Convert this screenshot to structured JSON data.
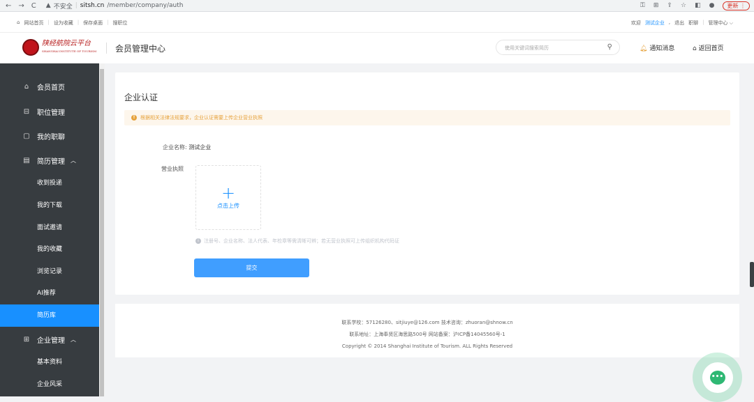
{
  "browser": {
    "back": "←",
    "forward": "→",
    "reload": "C",
    "insecure": "不安全",
    "host": "sitsh.cn",
    "path": "/member/company/auth",
    "update": "更新"
  },
  "topbar": {
    "links": [
      "网站首页",
      "设为收藏",
      "保存桌面",
      "搜职位"
    ],
    "welcome": "欢迎",
    "company": "测试企业",
    "logout": "退出",
    "chat": "职聊",
    "center": "管理中心"
  },
  "header": {
    "logo_text": "陕经航院云平台",
    "logo_sub": "SHANGHAI INSTITUTE OF TOURISM",
    "title": "会员管理中心",
    "search_placeholder": "使用关键词搜索简历",
    "notice": "通知消息",
    "back_home": "返回首页"
  },
  "sidebar": {
    "items": [
      {
        "label": "会员首页",
        "icon": "home-icon"
      },
      {
        "label": "职位管理",
        "icon": "briefcase-icon"
      },
      {
        "label": "我的职聊",
        "icon": "chat-icon"
      },
      {
        "label": "简历管理",
        "icon": "document-icon"
      }
    ],
    "resume_sub": [
      "收到投递",
      "我的下载",
      "面试邀请",
      "我的收藏",
      "浏览记录",
      "AI推荐",
      "简历库"
    ],
    "company_group": {
      "label": "企业管理",
      "icon": "building-icon"
    },
    "company_sub": [
      "基本资料",
      "企业风采"
    ]
  },
  "main": {
    "title": "企业认证",
    "alert": "根据相关法律法规要求，企业认证需要上传企业营业执照",
    "company_label": "企业名称:",
    "company_value": "测试企业",
    "license_label": "营业执照",
    "upload_text": "点击上传",
    "hint": "注册号、企业名称、法人代表、年检章等需清晰可辨；若无营业执照可上传组织机构代码证",
    "submit": "提交"
  },
  "footer": {
    "line1": "联系学校：57126280、sitjiuye@126.com 技术咨询：zhuoran@shnow.cn",
    "line2": "联系地址：上海奉贤区海思路500号 网站备案：沪ICP备14045560号-1",
    "line3": "Copyright © 2014 Shanghai Institute of Tourism. ALL Rights Reserved"
  }
}
